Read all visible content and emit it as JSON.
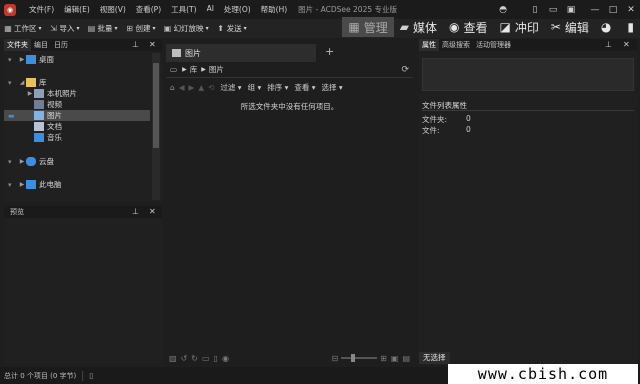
{
  "titlebar": {
    "menus": [
      "文件(F)",
      "编辑(E)",
      "视图(V)",
      "查看(P)",
      "工具(T)",
      "AI",
      "处理(O)",
      "帮助(H)"
    ],
    "title": "图片 - ACDSee 2025 专业版"
  },
  "toolbar": {
    "items": [
      "工作区",
      "导入",
      "批量",
      "创建",
      "幻灯放映",
      "发送"
    ]
  },
  "modes": {
    "manage": "管理",
    "media": "媒体",
    "view": "查看",
    "develop": "冲印",
    "edit": "编辑"
  },
  "left_panel": {
    "tabs": [
      "文件夹",
      "编目",
      "日历"
    ],
    "tree": {
      "desktop": "桌面",
      "library": "库",
      "local_photos": "本机照片",
      "videos": "视频",
      "pictures": "图片",
      "documents": "文档",
      "music": "音乐",
      "cloud": "云盘",
      "this_pc": "此电脑"
    }
  },
  "preview_panel": {
    "title": "预览"
  },
  "center": {
    "tab_label": "图片",
    "breadcrumb": [
      "库",
      "图片"
    ],
    "filters": [
      "过滤",
      "组",
      "排序",
      "查看",
      "选择"
    ],
    "empty_message": "所选文件夹中没有任何项目。"
  },
  "right_panel": {
    "tabs": [
      "属性",
      "高级搜索",
      "活动管理器"
    ],
    "section_title": "文件列表属性",
    "fields": [
      {
        "label": "文件夹:",
        "value": "0"
      },
      {
        "label": "文件:",
        "value": "0"
      }
    ],
    "bottom_tab": "无选择"
  },
  "statusbar": {
    "text": "总计 0 个项目 (0 字节)"
  },
  "watermark": "www.cbish.com",
  "colors": {
    "selection": "#4a4a4a",
    "folder": "#e8c25a",
    "accent": "#3c8fe0"
  }
}
